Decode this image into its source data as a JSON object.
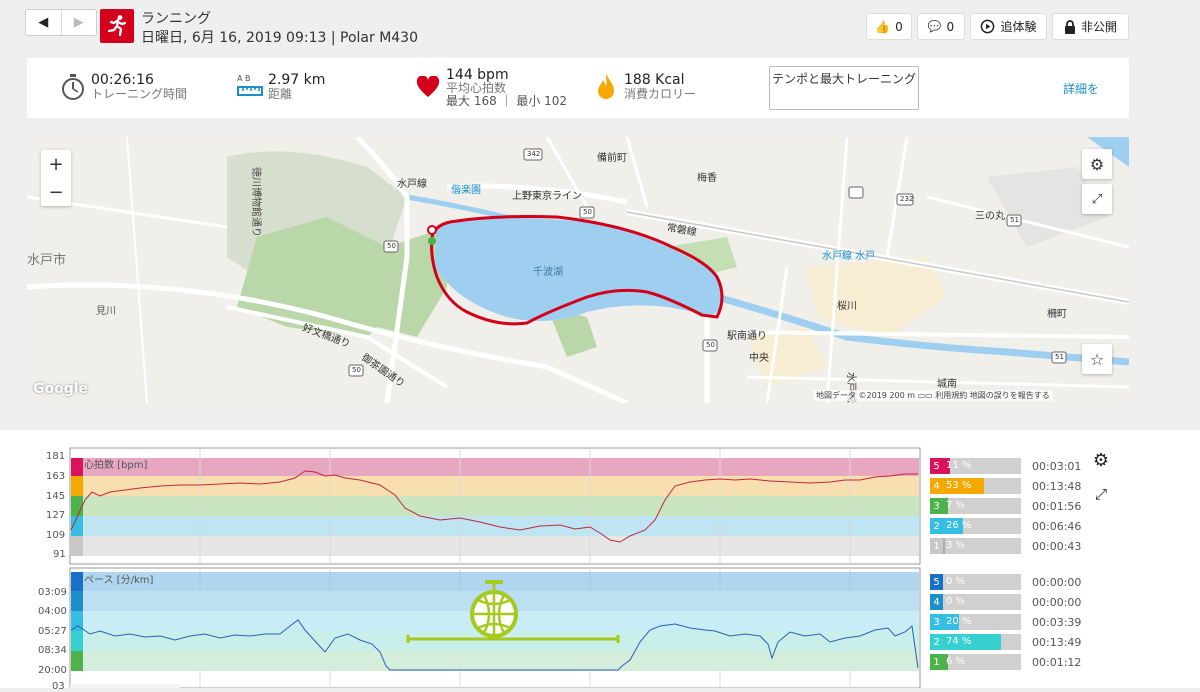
{
  "header": {
    "back_icon": "◀",
    "forward_icon": "▶",
    "sport": "ランニング",
    "subtitle": "日曜日, 6月 16, 2019 09:13 | Polar M430",
    "likes": "0",
    "comments": "0",
    "follow_label": "追体験",
    "privacy_label": "非公開"
  },
  "stats": {
    "duration": "00:26:16",
    "duration_label": "トレーニング時間",
    "distance": "2.97 km",
    "distance_label": "距離",
    "distance_ab": "A   B",
    "avg_hr": "144 bpm",
    "avg_hr_label": "平均心拍数",
    "hr_max_min": "最大 168 ｜ 最小 102",
    "calories": "188 Kcal",
    "calories_label": "消費カロリー",
    "tempo_button": "テンポと最大トレーニング",
    "detail_link": "詳細を"
  },
  "map": {
    "lake_label": "千波湖",
    "google": "Google",
    "attribution": "地図データ ©2019   200 m ▭▭   利用規約   地図の誤りを報告する",
    "labels": [
      {
        "text": "徳川博物館通り"
      },
      {
        "text": "水戸線"
      },
      {
        "text": "偕楽園"
      },
      {
        "text": "上野東京ライン"
      },
      {
        "text": "常磐線"
      },
      {
        "text": "水戸線 水戸"
      },
      {
        "text": "三の丸"
      },
      {
        "text": "備前町"
      },
      {
        "text": "梅香"
      },
      {
        "text": "桜川"
      },
      {
        "text": "柵町"
      },
      {
        "text": "中央"
      },
      {
        "text": "駅南通り"
      },
      {
        "text": "城南"
      },
      {
        "text": "好文橋通り"
      },
      {
        "text": "御茶園通り"
      },
      {
        "text": "見川"
      },
      {
        "text": "水戸市"
      },
      {
        "text": "水戸城通り"
      }
    ],
    "road_numbers": [
      "342",
      "50",
      "232",
      "51",
      "50",
      "50",
      "50",
      "51"
    ]
  },
  "colors": {
    "brand_red": "#d4001b",
    "link_blue": "#1a8fc9",
    "zone5": "#d9145c",
    "zone4": "#f5a800",
    "zone3": "#4db24a",
    "zone2": "#36bde3",
    "zone1": "#c8c8c8",
    "hr_line": "#c0263d",
    "pace_line": "#2a5fb8"
  },
  "hr_chart": {
    "title": "心拍数 [bpm]",
    "yticks": [
      "181",
      "163",
      "145",
      "127",
      "109",
      "91"
    ],
    "zones": [
      {
        "num": "5",
        "pct": "11 %",
        "time": "00:03:01",
        "fill": 0.11
      },
      {
        "num": "4",
        "pct": "53 %",
        "time": "00:13:48",
        "fill": 0.53
      },
      {
        "num": "3",
        "pct": "7 %",
        "time": "00:01:56",
        "fill": 0.07
      },
      {
        "num": "2",
        "pct": "26 %",
        "time": "00:06:46",
        "fill": 0.26
      },
      {
        "num": "1",
        "pct": "3 %",
        "time": "00:00:43",
        "fill": 0.03
      }
    ]
  },
  "pace_chart": {
    "title": "ペース [分/km]",
    "yticks": [
      "03:09",
      "04:00",
      "05:27",
      "08:34",
      "20:00"
    ],
    "partial_tick": "03",
    "zones": [
      {
        "num": "5",
        "pct": "0 %",
        "time": "00:00:00",
        "fill": 0.0
      },
      {
        "num": "4",
        "pct": "0 %",
        "time": "00:00:00",
        "fill": 0.0
      },
      {
        "num": "3",
        "pct": "20 %",
        "time": "00:03:39",
        "fill": 0.2
      },
      {
        "num": "2",
        "pct": "74 %",
        "time": "00:13:49",
        "fill": 0.74
      },
      {
        "num": "1",
        "pct": "6 %",
        "time": "00:01:12",
        "fill": 0.06
      }
    ]
  }
}
